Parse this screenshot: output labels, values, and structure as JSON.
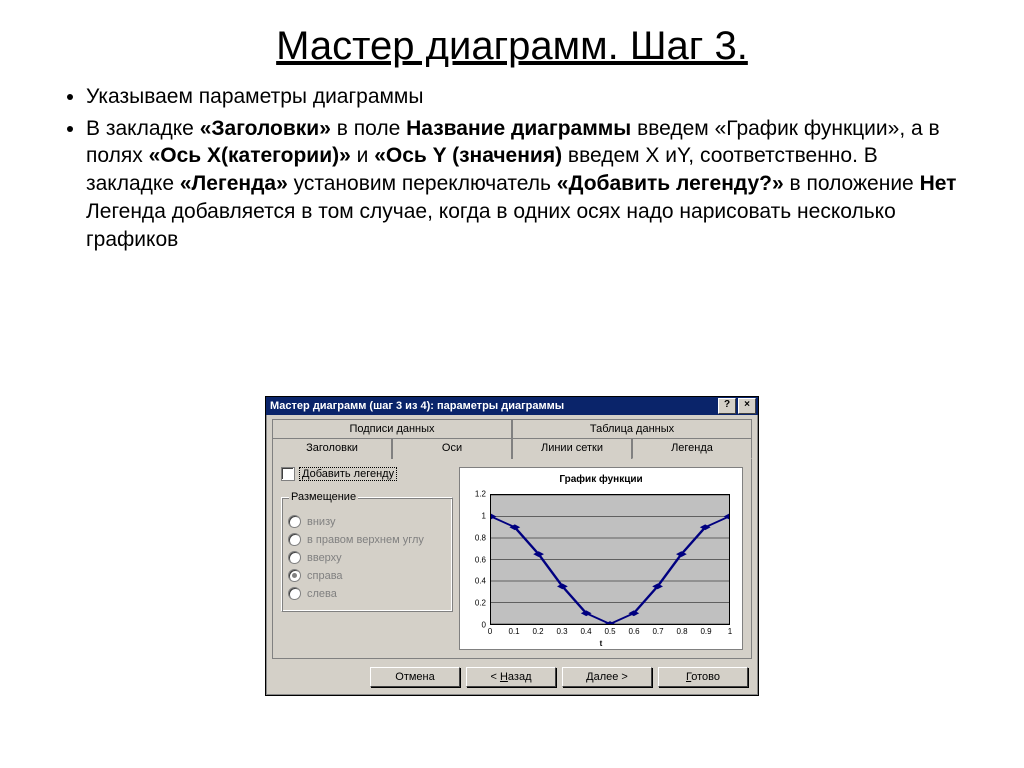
{
  "slide": {
    "title": "Мастер диаграмм. Шаг 3.",
    "bullet1": "Указываем параметры диаграммы",
    "b2": {
      "p1": "В закладке ",
      "b1": "«Заголовки»",
      "p2": " в поле ",
      "b2": "Название диаграммы",
      "p3": " введем «График функции», а в полях ",
      "b3": "«Ось Х(категории)»",
      "p4": " и ",
      "b4": "«Ось Y (значения)",
      "p5": " введем X иY, соответственно. В закладке ",
      "b5": "«Легенда»",
      "p6": " установим переключатель ",
      "b6": "«Добавить легенду?»",
      "p7": " в положение ",
      "b7": "Нет",
      "p8": " Легенда добавляется в том случае, когда в одних осях надо нарисовать несколько графиков"
    }
  },
  "dialog": {
    "title": "Мастер диаграмм (шаг 3 из 4): параметры диаграммы",
    "help": "?",
    "close": "×",
    "tabs_top": [
      "Подписи данных",
      "Таблица данных"
    ],
    "tabs_bottom": [
      "Заголовки",
      "Оси",
      "Линии сетки",
      "Легенда"
    ],
    "legend_checkbox": "Добавить легенду",
    "placement_label": "Размещение",
    "radios": [
      "внизу",
      "в правом верхнем углу",
      "вверху",
      "справа",
      "слева"
    ],
    "buttons": {
      "cancel": "Отмена",
      "back": "< Назад",
      "next": "Далее >",
      "finish": "Готово"
    }
  },
  "chart_data": {
    "type": "line",
    "title": "График функции",
    "xlabel": "t",
    "ylabel": "",
    "x": [
      0,
      0.1,
      0.2,
      0.3,
      0.4,
      0.5,
      0.6,
      0.7,
      0.8,
      0.9,
      1
    ],
    "y": [
      1.0,
      0.9,
      0.65,
      0.35,
      0.1,
      0.0,
      0.1,
      0.35,
      0.65,
      0.9,
      1.0
    ],
    "xticks": [
      0,
      0.1,
      0.2,
      0.3,
      0.4,
      0.5,
      0.6,
      0.7,
      0.8,
      0.9,
      1
    ],
    "yticks": [
      0,
      0.2,
      0.4,
      0.6,
      0.8,
      1,
      1.2
    ],
    "xlim": [
      0,
      1
    ],
    "ylim": [
      0,
      1.2
    ]
  }
}
